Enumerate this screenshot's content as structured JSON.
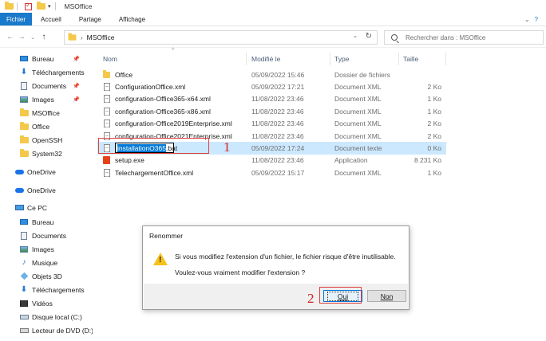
{
  "window": {
    "title": "MSOffice"
  },
  "ribbon": {
    "tabs": [
      "Fichier",
      "Accueil",
      "Partage",
      "Affichage"
    ]
  },
  "address": {
    "folder": "MSOffice"
  },
  "search": {
    "placeholder": "Rechercher dans : MSOffice"
  },
  "sidebar": {
    "items": [
      {
        "label": "Bureau",
        "icon": "desktop-icon",
        "pinned": true
      },
      {
        "label": "Téléchargements",
        "icon": "download-icon",
        "pinned": true
      },
      {
        "label": "Documents",
        "icon": "documents-icon",
        "pinned": true
      },
      {
        "label": "Images",
        "icon": "pictures-icon",
        "pinned": true
      },
      {
        "label": "MSOffice",
        "icon": "folder-icon"
      },
      {
        "label": "Office",
        "icon": "folder-icon"
      },
      {
        "label": "OpenSSH",
        "icon": "folder-icon"
      },
      {
        "label": "System32",
        "icon": "folder-icon"
      },
      {
        "label": "OneDrive",
        "icon": "cloud-icon"
      },
      {
        "label": "OneDrive",
        "icon": "cloud-icon"
      },
      {
        "label": "Ce PC",
        "icon": "pc-icon"
      },
      {
        "label": "Bureau",
        "icon": "desktop-icon"
      },
      {
        "label": "Documents",
        "icon": "documents-icon"
      },
      {
        "label": "Images",
        "icon": "pictures-icon"
      },
      {
        "label": "Musique",
        "icon": "music-icon"
      },
      {
        "label": "Objets 3D",
        "icon": "objects-3d-icon"
      },
      {
        "label": "Téléchargements",
        "icon": "download-icon"
      },
      {
        "label": "Vidéos",
        "icon": "videos-icon"
      },
      {
        "label": "Disque local (C:)",
        "icon": "disk-icon"
      },
      {
        "label": "Lecteur de DVD (D:)",
        "icon": "dvd-icon"
      }
    ]
  },
  "columns": {
    "name": "Nom",
    "date": "Modifié le",
    "type": "Type",
    "size": "Taille"
  },
  "files": [
    {
      "name": "Office",
      "date": "05/09/2022 15:46",
      "type": "Dossier de fichiers",
      "size": "",
      "icon": "folder-icon"
    },
    {
      "name": "ConfigurationOffice.xml",
      "date": "05/09/2022 17:21",
      "type": "Document XML",
      "size": "2 Ko",
      "icon": "file-icon"
    },
    {
      "name": "configuration-Office365-x64.xml",
      "date": "11/08/2022 23:46",
      "type": "Document XML",
      "size": "1 Ko",
      "icon": "file-icon"
    },
    {
      "name": "configuration-Office365-x86.xml",
      "date": "11/08/2022 23:46",
      "type": "Document XML",
      "size": "1 Ko",
      "icon": "file-icon"
    },
    {
      "name": "configuration-Office2019Enterprise.xml",
      "date": "11/08/2022 23:46",
      "type": "Document XML",
      "size": "2 Ko",
      "icon": "file-icon"
    },
    {
      "name": "configuration-Office2021Enterprise.xml",
      "date": "11/08/2022 23:46",
      "type": "Document XML",
      "size": "2 Ko",
      "icon": "file-icon"
    },
    {
      "name": "installationO365.bat",
      "date": "05/09/2022 17:24",
      "type": "Document texte",
      "size": "0 Ko",
      "icon": "file-icon",
      "selected": true,
      "renaming": true
    },
    {
      "name": "setup.exe",
      "date": "11/08/2022 23:46",
      "type": "Application",
      "size": "8 231 Ko",
      "icon": "setup-icon"
    },
    {
      "name": "TelechargementOffice.xml",
      "date": "05/09/2022 15:17",
      "type": "Document XML",
      "size": "1 Ko",
      "icon": "file-icon"
    }
  ],
  "rename": {
    "base": "installationO365",
    "ext": ".bat"
  },
  "annotations": {
    "step1": "1",
    "step2": "2"
  },
  "dialog": {
    "title": "Renommer",
    "message": "Si vous modifiez l'extension d'un fichier, le fichier risque d'être inutilisable.",
    "question": "Voulez-vous vraiment modifier l'extension ?",
    "yes": "Oui",
    "no": "Non"
  }
}
